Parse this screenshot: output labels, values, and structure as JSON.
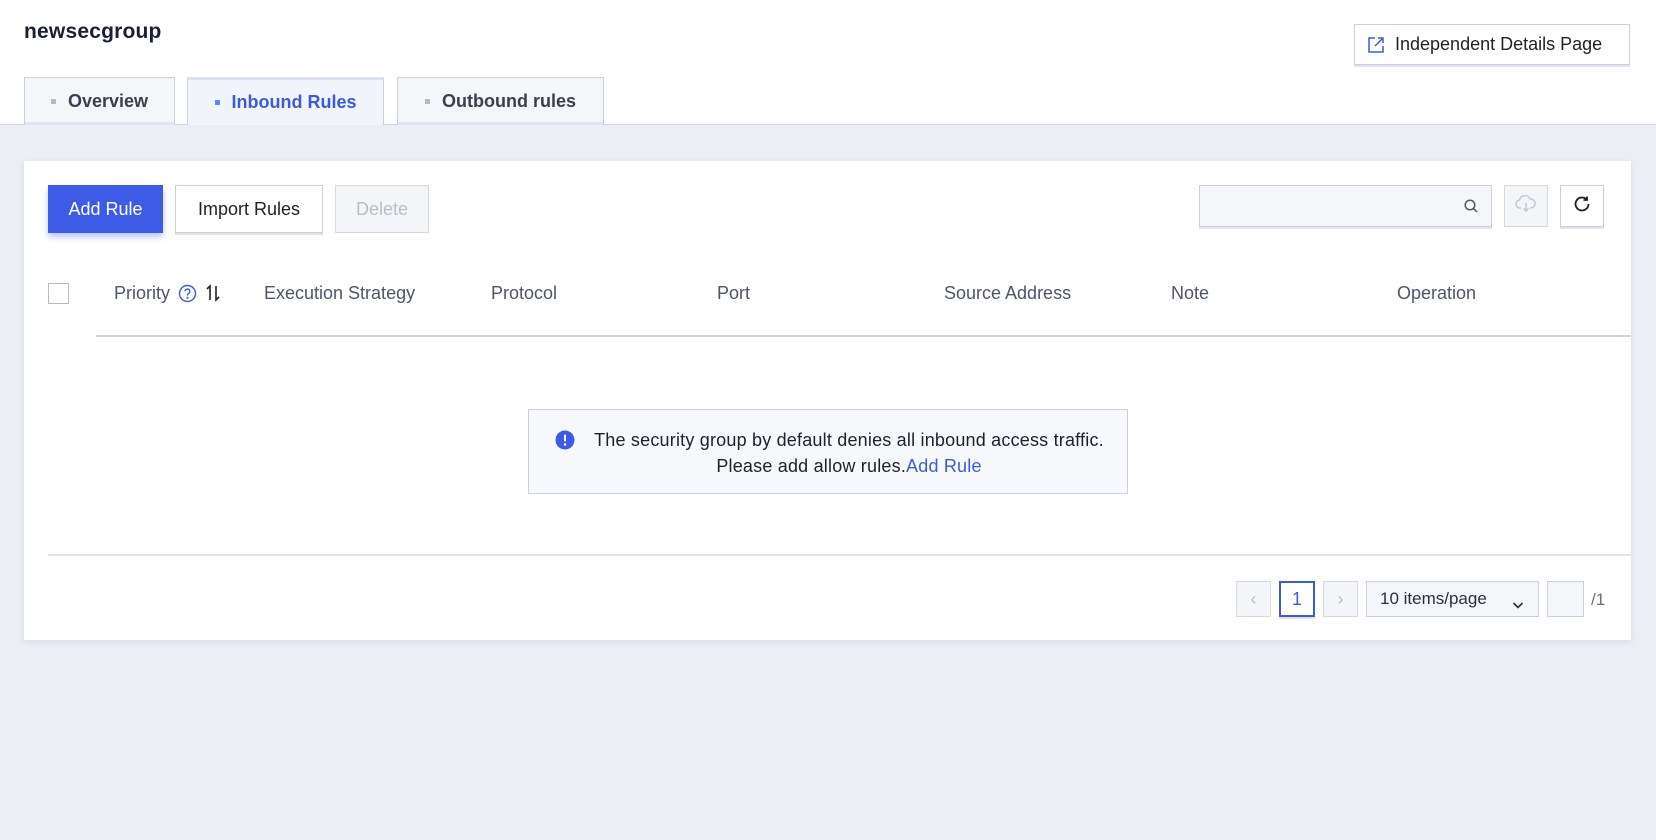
{
  "header": {
    "title": "newsecgroup",
    "details_button": "Independent Details Page"
  },
  "tabs": [
    {
      "label": "Overview",
      "active": false
    },
    {
      "label": "Inbound Rules",
      "active": true
    },
    {
      "label": "Outbound rules",
      "active": false
    }
  ],
  "toolbar": {
    "add_rule": "Add Rule",
    "import_rules": "Import Rules",
    "delete": "Delete",
    "search_placeholder": "",
    "download_icon": "cloud-download-icon",
    "refresh_icon": "refresh-icon"
  },
  "table": {
    "columns": [
      "Priority",
      "Execution Strategy",
      "Protocol",
      "Port",
      "Source Address",
      "Note",
      "Operation"
    ],
    "rows": [],
    "empty_message": "The security group by default denies all inbound access traffic. Please add allow rules.",
    "empty_link": "Add Rule"
  },
  "pagination": {
    "prev": "‹",
    "current_page": "1",
    "next": "›",
    "page_size": "10 items/page",
    "jump_value": "",
    "total_pages": "/1"
  },
  "colors": {
    "primary": "#3d5be6",
    "link": "#3b5bdb",
    "background": "#eceef6"
  }
}
